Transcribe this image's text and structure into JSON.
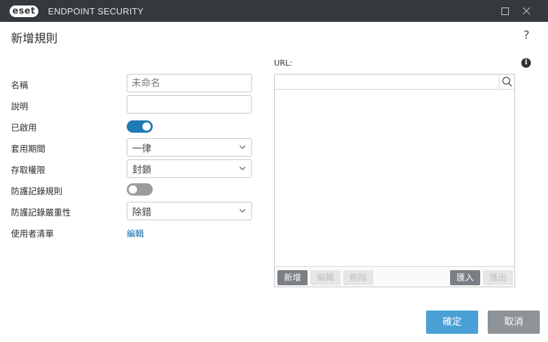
{
  "window": {
    "logo_text": "eset",
    "product_name": "ENDPOINT SECURITY",
    "maximize_label": "Maximize",
    "close_label": "Close"
  },
  "header": {
    "title": "新增規則",
    "help": "?"
  },
  "form": {
    "name_label": "名稱",
    "name_placeholder": "未命名",
    "description_label": "說明",
    "description_value": "",
    "enabled_label": "已啟用",
    "enabled": true,
    "period_label": "套用期間",
    "period_value": "一律",
    "access_label": "存取權限",
    "access_value": "封鎖",
    "log_rule_label": "防護記錄規則",
    "log_rule_enabled": false,
    "severity_label": "防護記錄嚴重性",
    "severity_value": "除錯",
    "user_list_label": "使用者清單",
    "user_list_link": "編輯"
  },
  "url_panel": {
    "label": "URL:",
    "info_icon": "i",
    "search_value": "",
    "items": [],
    "buttons": {
      "add": "新增",
      "edit": "編輯",
      "delete": "刪除",
      "import": "匯入",
      "export": "匯出"
    }
  },
  "footer": {
    "ok": "確定",
    "cancel": "取消"
  },
  "colors": {
    "titlebar": "#35393e",
    "toggle_on": "#1f7bb5",
    "toggle_off": "#9c9c9c",
    "ok_button": "#4aa0d5",
    "cancel_button": "#8e9398",
    "link": "#1a6fa8"
  }
}
